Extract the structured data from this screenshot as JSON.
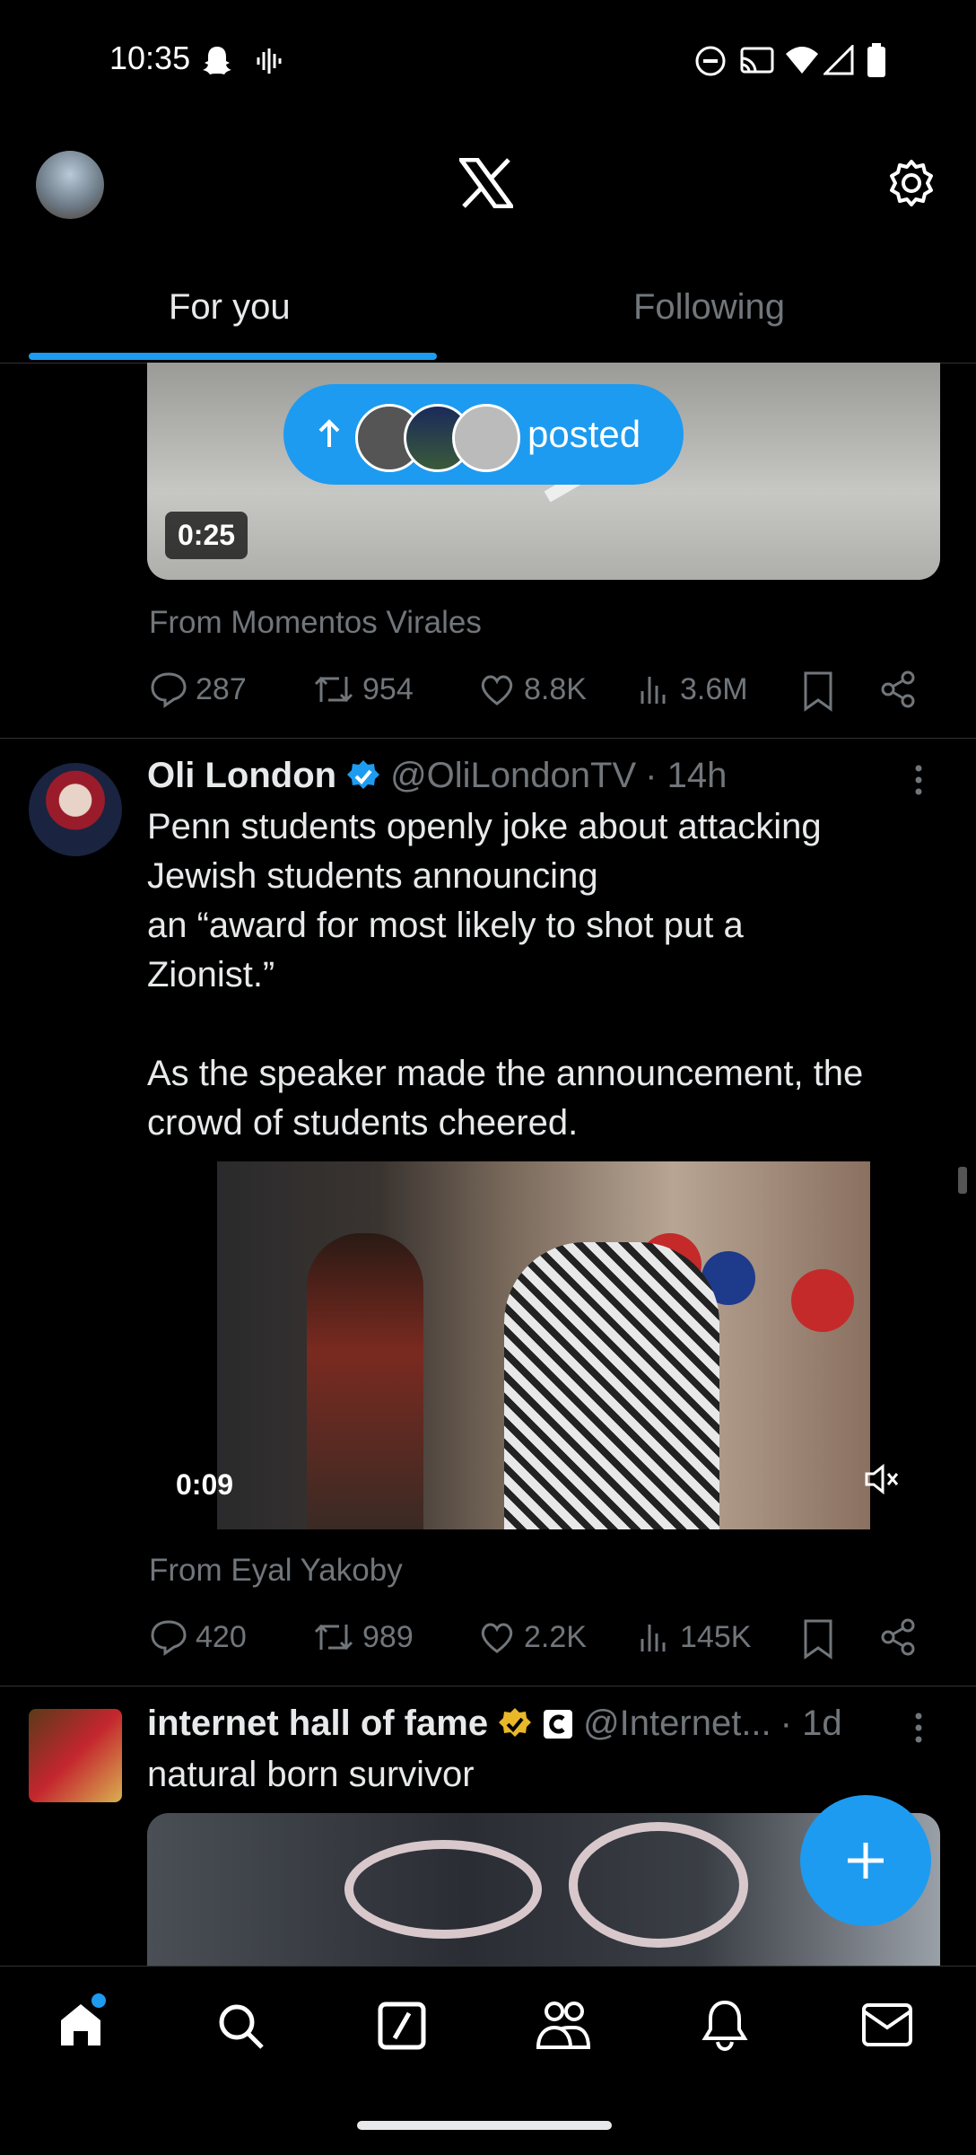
{
  "status": {
    "time": "10:35"
  },
  "header": {
    "logo": "X"
  },
  "tabs": [
    {
      "label": "For you",
      "active": true
    },
    {
      "label": "Following",
      "active": false
    }
  ],
  "new_posts_pill": {
    "label": "posted"
  },
  "tweet1": {
    "duration": "0:25",
    "from": "From Momentos Virales",
    "replies": "287",
    "retweets": "954",
    "likes": "8.8K",
    "views": "3.6M"
  },
  "tweet2": {
    "name": "Oli London",
    "handle": "@OliLondonTV",
    "time": "· 14h",
    "text": "Penn students openly joke about attacking\nJewish students announcing\nan “award for most likely to shot put a\nZionist.”\n\nAs the speaker made the announcement, the\ncrowd of students cheered.",
    "duration": "0:09",
    "from": "From Eyal Yakoby",
    "replies": "420",
    "retweets": "989",
    "likes": "2.2K",
    "views": "145K"
  },
  "tweet3": {
    "name": "internet hall of fame",
    "handle": "@Internet...",
    "time": "· 1d",
    "text": "natural born survivor"
  },
  "colors": {
    "accent": "#1d9bf0",
    "gold": "#e8b829"
  }
}
